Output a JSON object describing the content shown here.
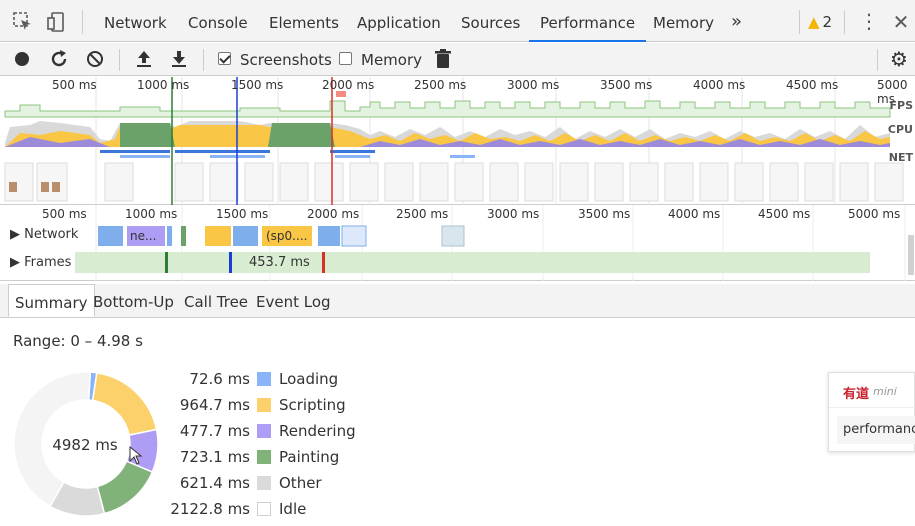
{
  "tabs": [
    {
      "label": "Network"
    },
    {
      "label": "Console"
    },
    {
      "label": "Elements"
    },
    {
      "label": "Application"
    },
    {
      "label": "Sources"
    },
    {
      "label": "Performance",
      "active": true
    },
    {
      "label": "Memory"
    }
  ],
  "more_tabs_icon": "chevron-double-right",
  "warnings": {
    "count": "2"
  },
  "toolbar": {
    "screenshots_label": "Screenshots",
    "screenshots_checked": true,
    "memory_label": "Memory",
    "memory_checked": false
  },
  "overview": {
    "ticks": [
      "500 ms",
      "1000 ms",
      "1500 ms",
      "2000 ms",
      "2500 ms",
      "3000 ms",
      "3500 ms",
      "4000 ms",
      "4500 ms",
      "5000 ms"
    ],
    "fps_label": "FPS",
    "cpu_label": "CPU",
    "net_label": "NET"
  },
  "flame": {
    "ticks": [
      "500 ms",
      "1000 ms",
      "1500 ms",
      "2000 ms",
      "2500 ms",
      "3000 ms",
      "3500 ms",
      "4000 ms",
      "4500 ms",
      "5000 ms"
    ],
    "network_label": "Network",
    "network_item_1": "ne...",
    "network_item_2": "(sp0....",
    "frames_label": "Frames",
    "frame_duration": "453.7 ms"
  },
  "subtabs": [
    {
      "label": "Summary",
      "active": true
    },
    {
      "label": "Bottom-Up"
    },
    {
      "label": "Call Tree"
    },
    {
      "label": "Event Log"
    }
  ],
  "summary": {
    "range": "Range: 0 – 4.98 s",
    "total": "4982 ms",
    "items": [
      {
        "value": "72.6 ms",
        "name": "Loading",
        "color": "#8ab4f8",
        "ms": 72.6
      },
      {
        "value": "964.7 ms",
        "name": "Scripting",
        "color": "#fcd16b",
        "ms": 964.7
      },
      {
        "value": "477.7 ms",
        "name": "Rendering",
        "color": "#af9cf4",
        "ms": 477.7
      },
      {
        "value": "723.1 ms",
        "name": "Painting",
        "color": "#81b27a",
        "ms": 723.1
      },
      {
        "value": "621.4 ms",
        "name": "Other",
        "color": "#dadada",
        "ms": 621.4
      },
      {
        "value": "2122.8 ms",
        "name": "Idle",
        "color": "#ffffff",
        "ms": 2122.8
      }
    ]
  },
  "popup": {
    "brand": "有道",
    "mini": "mini",
    "input_text": "performance"
  }
}
